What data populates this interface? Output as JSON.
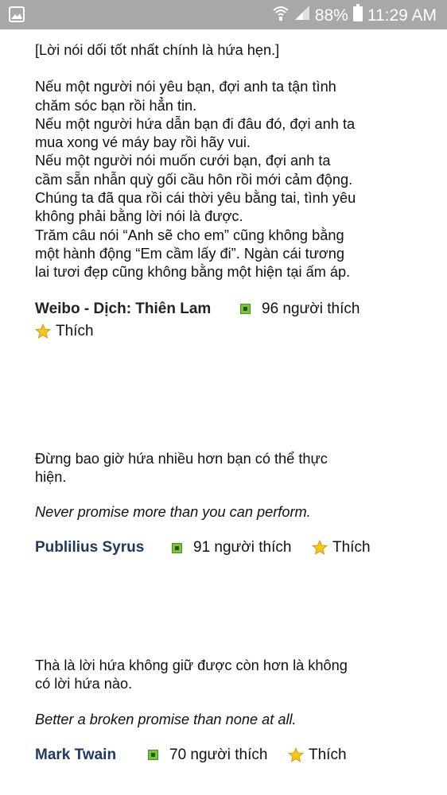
{
  "status": {
    "battery_percent": "88%",
    "time": "11:29 AM"
  },
  "quotes": [
    {
      "lines": [
        "[Lời nói dối tốt nhất chính là hứa hẹn.]",
        "",
        "Nếu một người nói yêu bạn, đợi anh ta tận tình",
        "chăm sóc bạn rồi hẳn tin.",
        "Nếu một người hứa dẫn bạn đi đâu đó, đợi anh ta",
        "mua xong vé máy bay rồi hãy vui.",
        "Nếu một người nói muốn cưới bạn, đợi anh ta",
        "cầm sẵn nhẫn quỳ gối cầu hôn rồi mới cảm động.",
        "Chúng ta đã qua rồi cái thời yêu bằng tai, tình yêu",
        "không phải bằng lời nói là được.",
        "Trăm câu nói “Anh sẽ cho em” cũng không bằng",
        "một hành động “Em cầm lấy đi”. Ngàn cái tương",
        "lai tươi đẹp cũng không bằng một hiện tại ấm áp."
      ],
      "author": "Weibo - Dịch: Thiên Lam",
      "likes": "96 người thích",
      "like_label": "Thích"
    },
    {
      "lines": [
        "Đừng bao giờ hứa nhiều hơn bạn có thể thực",
        "hiện."
      ],
      "english": "Never promise more than you can perform.",
      "author": "Publilius Syrus",
      "likes": "91 người thích",
      "like_label": "Thích"
    },
    {
      "lines": [
        "Thà là lời hứa không giữ được còn hơn là không",
        "có lời hứa nào."
      ],
      "english": "Better a broken promise than none at all.",
      "author": "Mark Twain",
      "likes": "70 người thích",
      "like_label": "Thích"
    }
  ]
}
